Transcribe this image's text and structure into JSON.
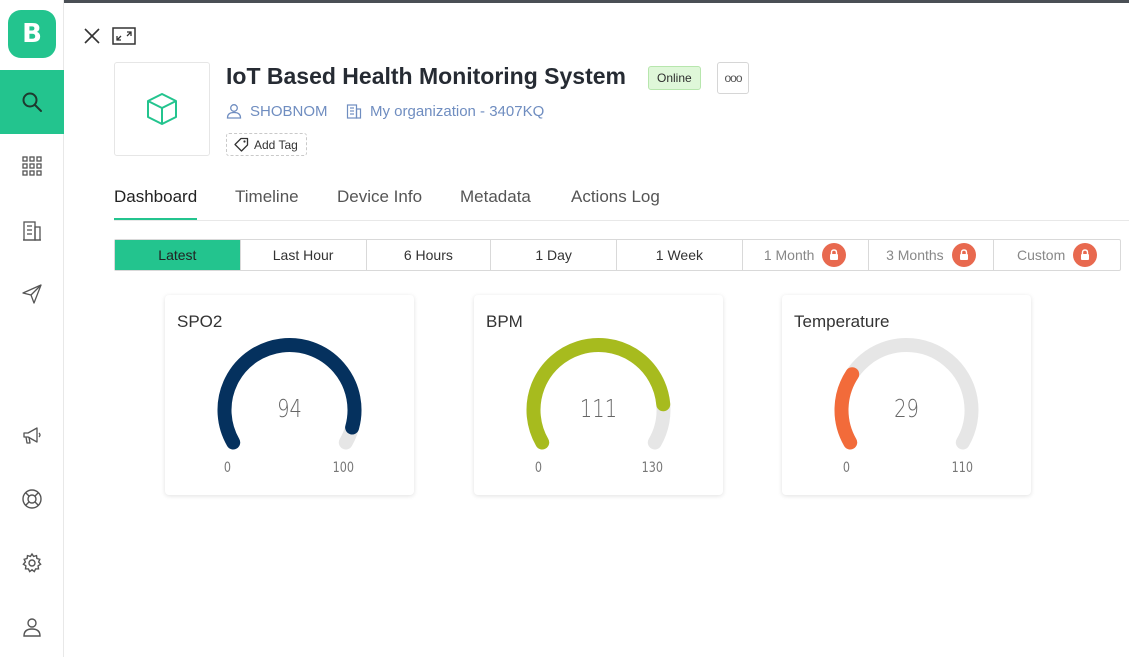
{
  "app": {
    "logo_letter": "B"
  },
  "header": {
    "title": "IoT Based Health Monitoring System",
    "status": "Online",
    "more_label": "ooo",
    "owner": "SHOBNOM",
    "organization": "My organization - 3407KQ",
    "add_tag_label": "Add Tag"
  },
  "tabs": [
    {
      "label": "Dashboard",
      "active": true
    },
    {
      "label": "Timeline"
    },
    {
      "label": "Device Info"
    },
    {
      "label": "Metadata"
    },
    {
      "label": "Actions Log"
    }
  ],
  "ranges": [
    {
      "label": "Latest",
      "active": true
    },
    {
      "label": "Last Hour"
    },
    {
      "label": "6 Hours"
    },
    {
      "label": "1 Day"
    },
    {
      "label": "1 Week"
    },
    {
      "label": "1 Month",
      "locked": true
    },
    {
      "label": "3 Months",
      "locked": true
    },
    {
      "label": "Custom",
      "locked": true
    }
  ],
  "widgets": [
    {
      "title": "SPO2",
      "value": "94",
      "min": "0",
      "max": "100",
      "fraction": 0.94,
      "color": "#05315e"
    },
    {
      "title": "BPM",
      "value": "111",
      "min": "0",
      "max": "130",
      "fraction": 0.854,
      "color": "#a7bb1e"
    },
    {
      "title": "Temperature",
      "value": "29",
      "min": "0",
      "max": "110",
      "fraction": 0.264,
      "color": "#f26b3a"
    }
  ],
  "colors": {
    "accent": "#23c48e",
    "link": "#6f8dc0",
    "lock": "#e8694f",
    "gauge_track": "#e6e6e6"
  }
}
